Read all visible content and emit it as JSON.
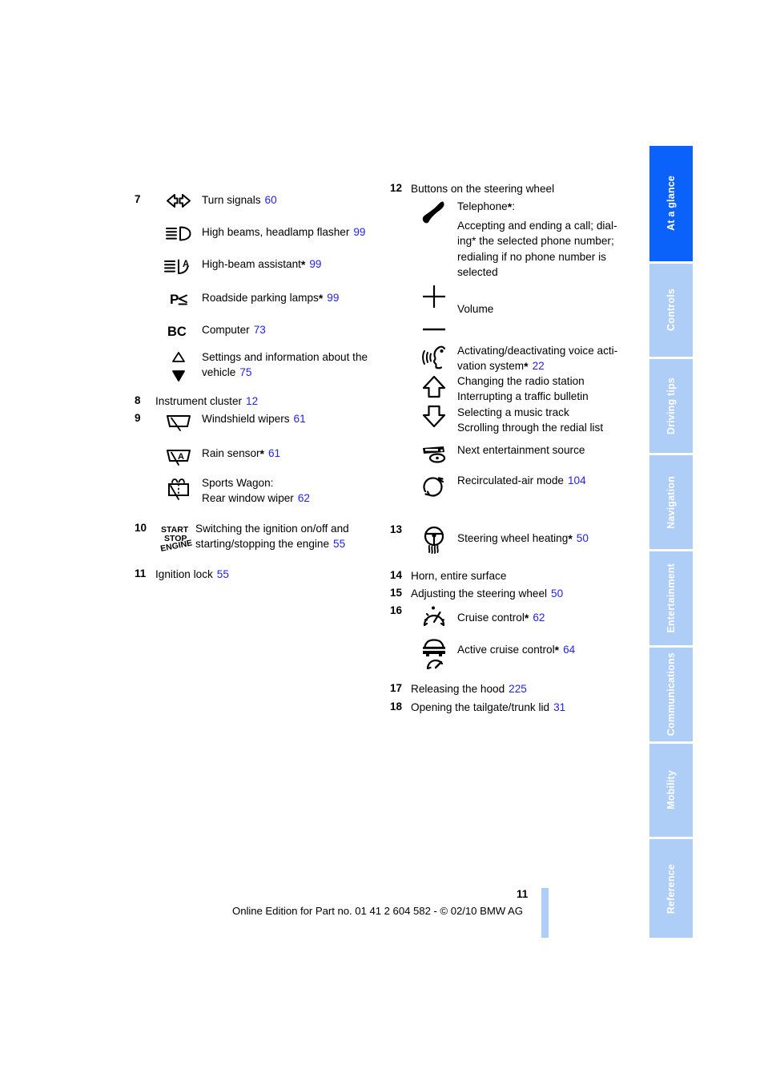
{
  "page": {
    "number": "11",
    "footer": "Online Edition for Part no. 01 41 2 604 582 - © 02/10 BMW AG"
  },
  "colors": {
    "page_ref_blue": "#2323ea",
    "tab_active": "#0a62fb",
    "tab_inactive": "#aecdf7",
    "tab_text": "#ffffff"
  },
  "sidebar": {
    "tabs": [
      {
        "label": "At a glance",
        "active": true
      },
      {
        "label": "Controls",
        "active": false
      },
      {
        "label": "Driving tips",
        "active": false
      },
      {
        "label": "Navigation",
        "active": false
      },
      {
        "label": "Entertainment",
        "active": false
      },
      {
        "label": "Communications",
        "active": false
      },
      {
        "label": "Mobility",
        "active": false
      },
      {
        "label": "Reference",
        "active": false
      }
    ]
  },
  "left_column": {
    "item7": {
      "number": "7",
      "entries": [
        {
          "icon": "turn-signals-icon",
          "label": "Turn signals",
          "page": "60"
        },
        {
          "icon": "high-beams-icon",
          "label": "High beams, headlamp flasher",
          "page": "99"
        },
        {
          "icon": "high-beam-assistant-icon",
          "label": "High-beam assistant",
          "star": "*",
          "page": "99"
        },
        {
          "icon": "roadside-parking-lamps-icon",
          "label": "Roadside parking lamps",
          "star": "*",
          "page": "99"
        },
        {
          "icon": "bc-computer-icon",
          "label": "Computer",
          "page": "73"
        },
        {
          "icon": "up-down-triangles-icon",
          "label_line1": "Settings and information about the",
          "label_line2": "vehicle",
          "page": "75"
        }
      ]
    },
    "item8": {
      "number": "8",
      "label": "Instrument cluster",
      "page": "12"
    },
    "item9": {
      "number": "9",
      "entries": [
        {
          "icon": "windshield-wipers-icon",
          "label": "Windshield wipers",
          "page": "61"
        },
        {
          "icon": "rain-sensor-icon",
          "label": "Rain sensor",
          "star": "*",
          "page": "61"
        },
        {
          "icon": "rear-window-wiper-icon",
          "label_line1": "Sports Wagon:",
          "label_line2": "Rear window wiper",
          "page": "62"
        }
      ]
    },
    "item10": {
      "number": "10",
      "icon": "start-stop-engine-icon",
      "label_line1": "Switching the ignition on/off and",
      "label_line2": "starting/stopping the engine",
      "page": "55"
    },
    "item11": {
      "number": "11",
      "label": "Ignition lock",
      "page": "55"
    }
  },
  "right_column": {
    "item12": {
      "number": "12",
      "heading": "Buttons on the steering wheel",
      "entries": [
        {
          "icon": "telephone-icon",
          "title": "Telephone",
          "star": "*",
          "title_suffix": ":",
          "body_lines": [
            "Accepting and ending a call; dial-",
            "ing* the selected phone number;",
            "redialing if no phone number is",
            "selected"
          ]
        },
        {
          "icon": "volume-plus-minus-icon",
          "label": "Volume"
        },
        {
          "icon": "voice-activation-icon",
          "label_line1": "Activating/deactivating voice acti-",
          "label_line2": "vation system",
          "star": "*",
          "page": "22"
        },
        {
          "icon": "up-down-arrows-icon",
          "lines": [
            "Changing the radio station",
            "Interrupting a traffic bulletin",
            "Selecting a music track",
            "Scrolling through the redial list"
          ]
        },
        {
          "icon": "entertainment-source-icon",
          "label": "Next entertainment source"
        },
        {
          "icon": "recirculated-air-icon",
          "label": "Recirculated-air mode",
          "page": "104"
        }
      ]
    },
    "item13": {
      "number": "13",
      "icon": "steering-wheel-heating-icon",
      "label": "Steering wheel heating",
      "star": "*",
      "page": "50"
    },
    "item14": {
      "number": "14",
      "label": "Horn, entire surface"
    },
    "item15": {
      "number": "15",
      "label": "Adjusting the steering wheel",
      "page": "50"
    },
    "item16": {
      "number": "16",
      "entries": [
        {
          "icon": "cruise-control-icon",
          "label": "Cruise control",
          "star": "*",
          "page": "62"
        },
        {
          "icon": "active-cruise-control-icon",
          "label": "Active cruise control",
          "star": "*",
          "page": "64"
        }
      ]
    },
    "item17": {
      "number": "17",
      "label": "Releasing the hood",
      "page": "225"
    },
    "item18": {
      "number": "18",
      "label": "Opening the tailgate/trunk lid",
      "page": "31"
    }
  }
}
